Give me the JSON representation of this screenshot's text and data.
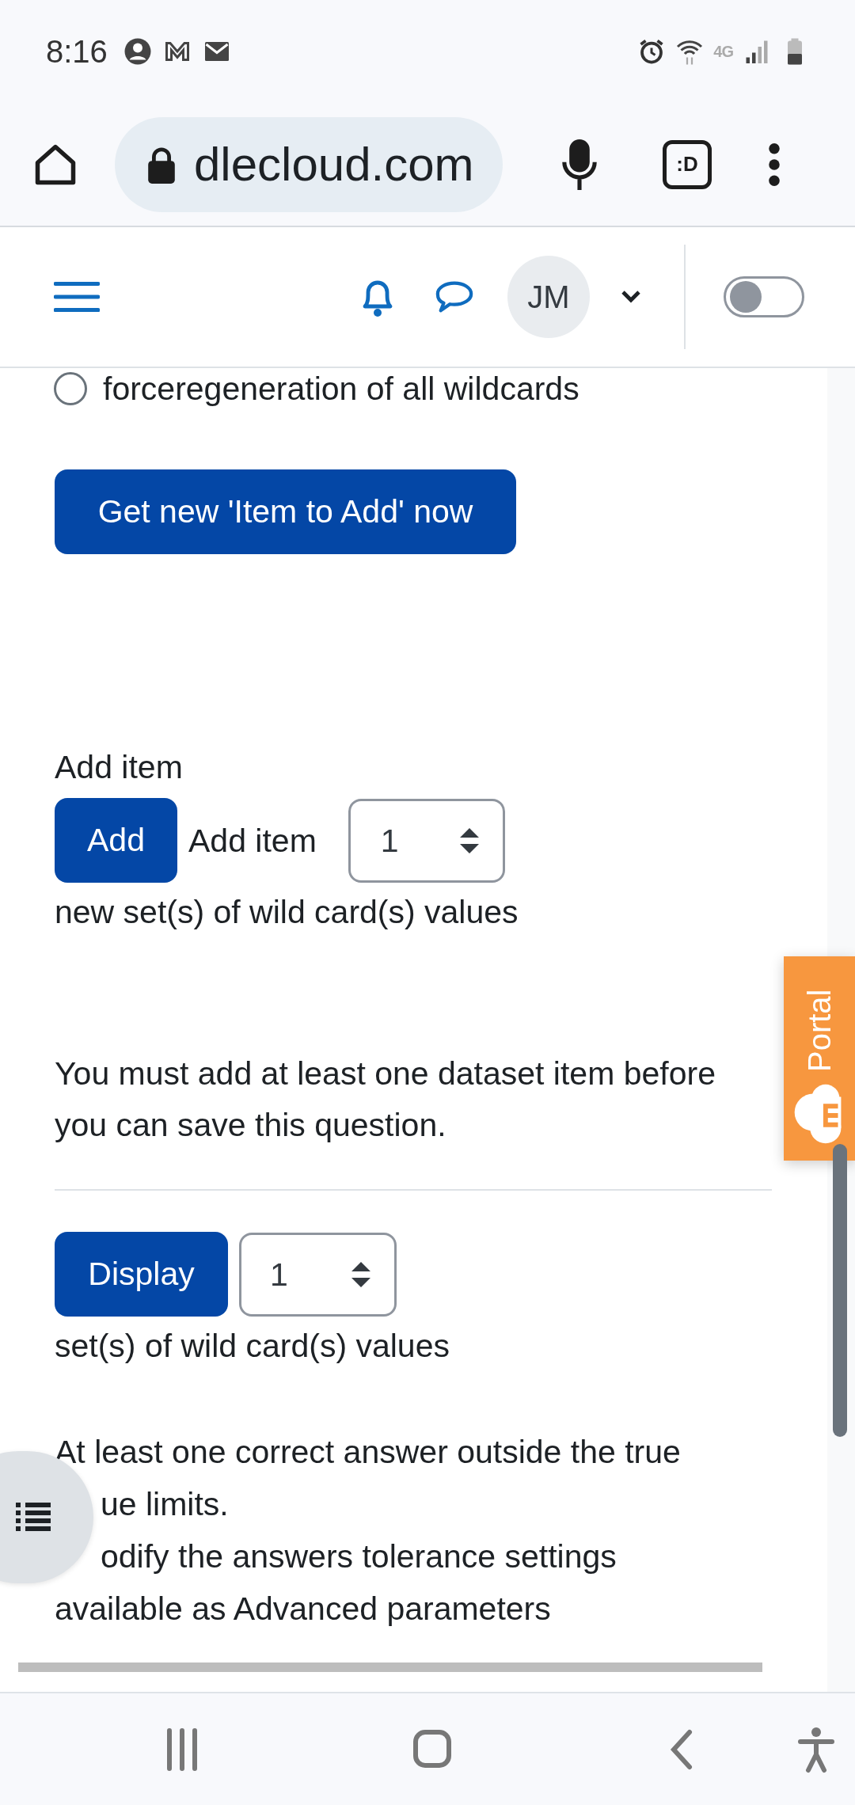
{
  "status_bar": {
    "time": "8:16",
    "network": "4G"
  },
  "browser": {
    "url": "dlecloud.com",
    "tab_button": ":D"
  },
  "navbar": {
    "avatar_initials": "JM",
    "edit_mode_toggle": {
      "on": false
    }
  },
  "form": {
    "radio": {
      "label": "forceregeneration of all wildcards",
      "checked": false
    },
    "get_new_button": "Get new 'Item to Add' now",
    "add_item_label": "Add item",
    "add_button": "Add",
    "add_select_label": "Add item",
    "add_select_value": "1",
    "add_suffix": "new set(s) of wild card(s) values",
    "notice": "You must add at least one dataset item before you can save this question.",
    "display_button": "Display",
    "display_select_value": "1",
    "display_suffix": "set(s) of wild card(s) values",
    "warning_lines": [
      {
        "text": "At least one correct answer outside the true",
        "kind": "full"
      },
      {
        "text": "ue limits.",
        "kind": "partial"
      },
      {
        "text": "odify the answers tolerance settings",
        "kind": "partial"
      },
      {
        "text": "available as Advanced parameters",
        "kind": "full"
      }
    ]
  },
  "portal_tab": "Portal"
}
